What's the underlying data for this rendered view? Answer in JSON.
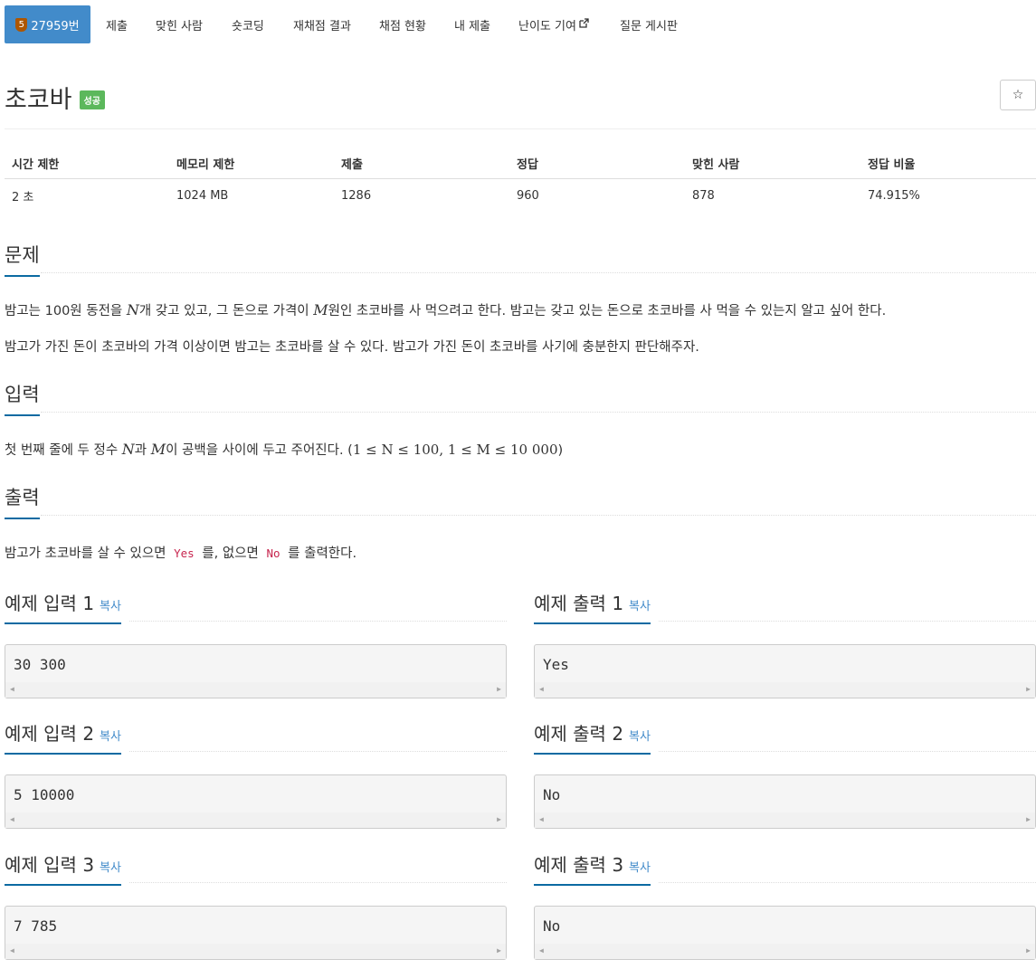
{
  "nav": {
    "problem_number": "27959번",
    "tier_mark": "5",
    "items": [
      "제출",
      "맞힌 사람",
      "숏코딩",
      "재채점 결과",
      "채점 현황",
      "내 제출",
      "난이도 기여",
      "질문 게시판"
    ],
    "external_icon": "external-link-icon"
  },
  "problem": {
    "title": "초코바",
    "status_badge": "성공",
    "star_icon": "☆"
  },
  "info_table": {
    "headers": [
      "시간 제한",
      "메모리 제한",
      "제출",
      "정답",
      "맞힌 사람",
      "정답 비율"
    ],
    "values": [
      "2 초",
      "1024 MB",
      "1286",
      "960",
      "878",
      "74.915%"
    ]
  },
  "sections": {
    "description_title": "문제",
    "description_p1_a": "밤고는 100원 동전을 ",
    "description_p1_var1": "N",
    "description_p1_b": "개 갖고 있고, 그 돈으로 가격이 ",
    "description_p1_var2": "M",
    "description_p1_c": "원인 초코바를 사 먹으려고 한다. 밤고는 갖고 있는 돈으로 초코바를 사 먹을 수 있는지 알고 싶어 한다.",
    "description_p2": "밤고가 가진 돈이 초코바의 가격 이상이면 밤고는 초코바를 살 수 있다. 밤고가 가진 돈이 초코바를 사기에 충분한지 판단해주자.",
    "input_title": "입력",
    "input_a": "첫 번째 줄에 두 정수 ",
    "input_var1": "N",
    "input_b": "과 ",
    "input_var2": "M",
    "input_c": "이 공백을 사이에 두고 주어진다. (",
    "input_math": "1 ≤ N ≤ 100, 1 ≤ M ≤ 10 000",
    "input_d": ")",
    "output_title": "출력",
    "output_a": "밤고가 초코바를 살 수 있으면 ",
    "output_yes": "Yes",
    "output_b": " 를, 없으면 ",
    "output_no": "No",
    "output_c": " 를 출력한다."
  },
  "samples": {
    "copy_label": "복사",
    "items": [
      {
        "input_title": "예제 입력 1",
        "input": "30 300",
        "output_title": "예제 출력 1",
        "output": "Yes"
      },
      {
        "input_title": "예제 입력 2",
        "input": "5 10000",
        "output_title": "예제 출력 2",
        "output": "No"
      },
      {
        "input_title": "예제 입력 3",
        "input": "7 785",
        "output_title": "예제 출력 3",
        "output": "No"
      }
    ]
  },
  "colors": {
    "nav_active": "#428bca",
    "tier_bronze": "#ad5600",
    "success_badge": "#5cb85c",
    "heading_underline": "#0b6aa2",
    "inline_code": "#c7254e"
  }
}
